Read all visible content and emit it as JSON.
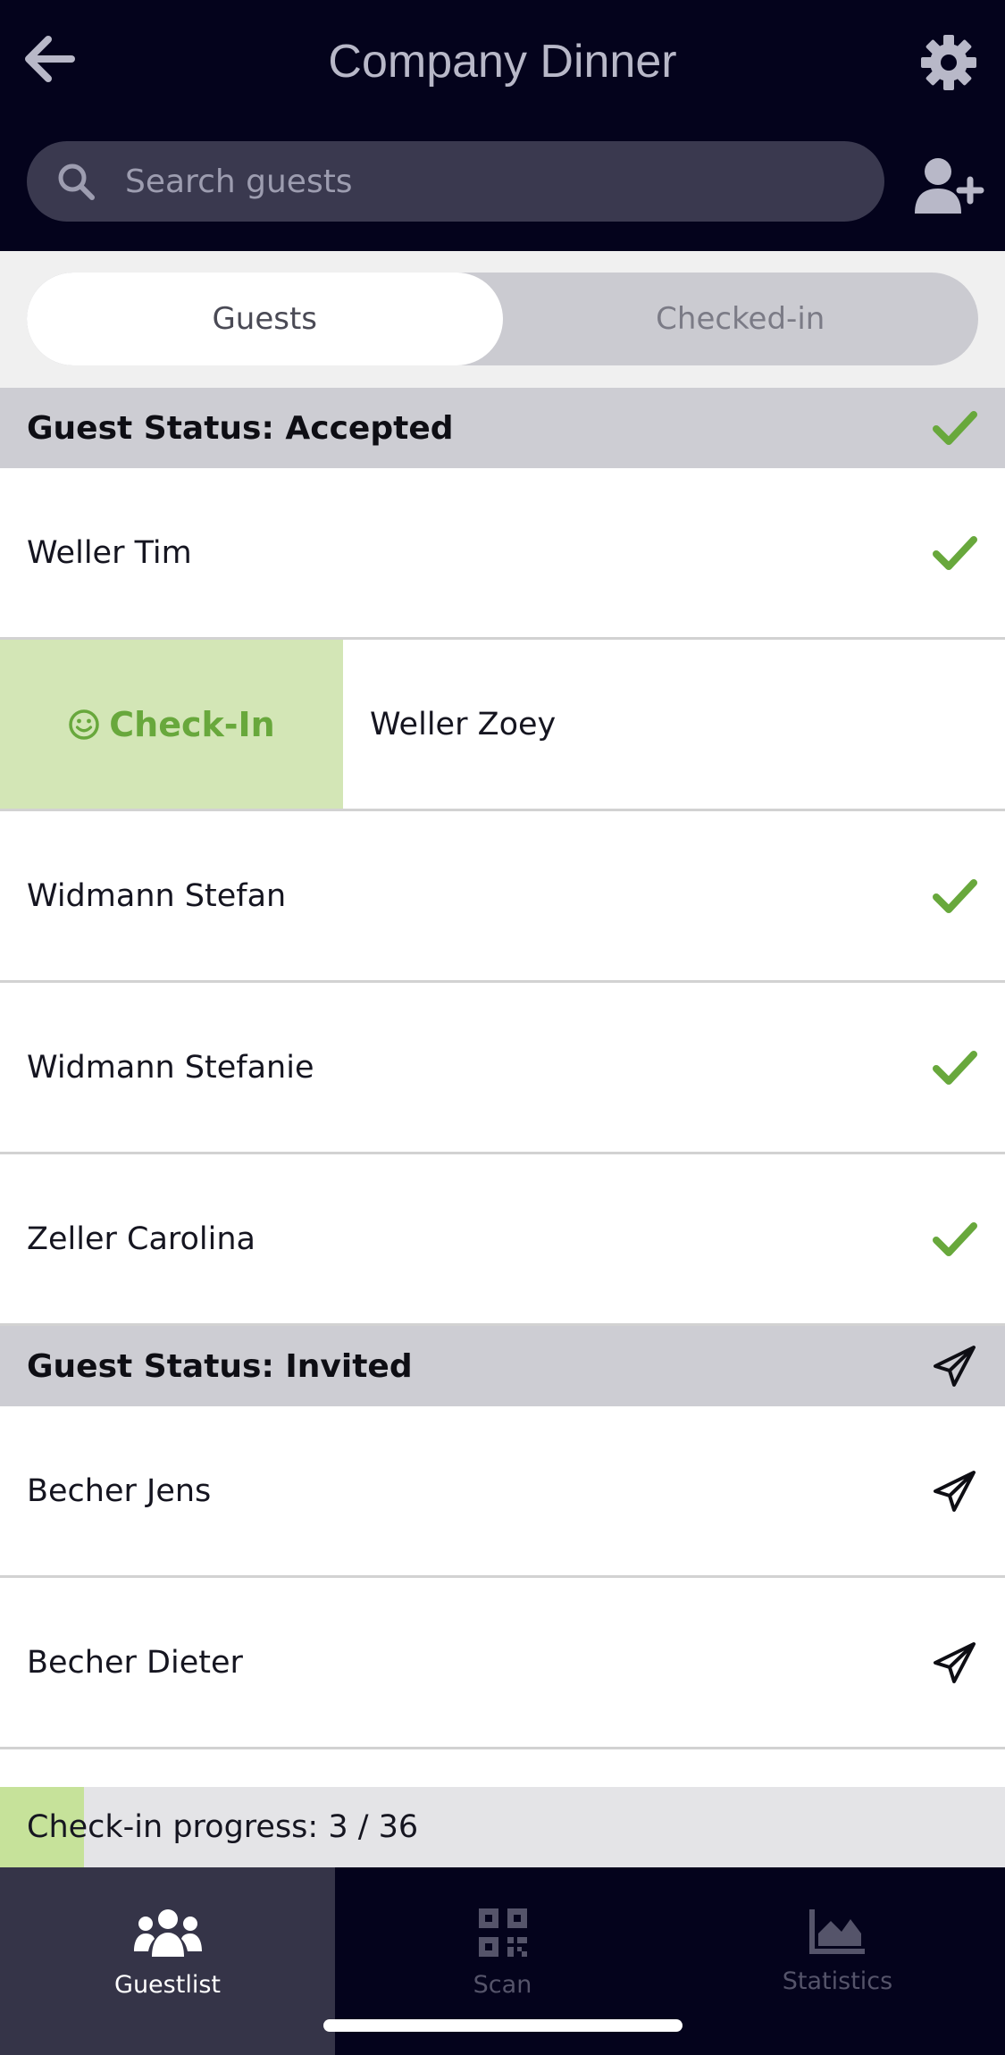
{
  "header": {
    "title": "Company Dinner",
    "back_icon": "arrow-left-icon",
    "settings_icon": "gear-icon",
    "add_guest_icon": "user-plus-icon"
  },
  "search": {
    "placeholder": "Search guests",
    "value": ""
  },
  "tabs": [
    {
      "label": "Guests",
      "active": true
    },
    {
      "label": "Checked-in",
      "active": false
    }
  ],
  "sections": [
    {
      "label": "Guest Status: Accepted",
      "icon": "checkmark-icon",
      "guests": [
        {
          "name": "Weller Tim"
        },
        {
          "name": "Weller Zoey",
          "swipe_action": "Check-In"
        },
        {
          "name": "Widmann Stefan"
        },
        {
          "name": "Widmann Stefanie"
        },
        {
          "name": "Zeller Carolina"
        }
      ]
    },
    {
      "label": "Guest Status: Invited",
      "icon": "paper-plane-icon",
      "guests": [
        {
          "name": "Becher Jens"
        },
        {
          "name": "Becher Dieter"
        }
      ]
    }
  ],
  "progress": {
    "text": "Check-in progress: 3 / 36",
    "checked_in": 3,
    "total": 36
  },
  "nav": [
    {
      "label": "Guestlist",
      "icon": "users-icon",
      "active": true
    },
    {
      "label": "Scan",
      "icon": "qr-code-icon",
      "active": false
    },
    {
      "label": "Statistics",
      "icon": "area-chart-icon",
      "active": false
    }
  ],
  "colors": {
    "header_bg": "#04031c",
    "accent_green": "#68a83c",
    "swipe_bg": "#d3e6b6",
    "section_bg": "#cdcdd3"
  }
}
